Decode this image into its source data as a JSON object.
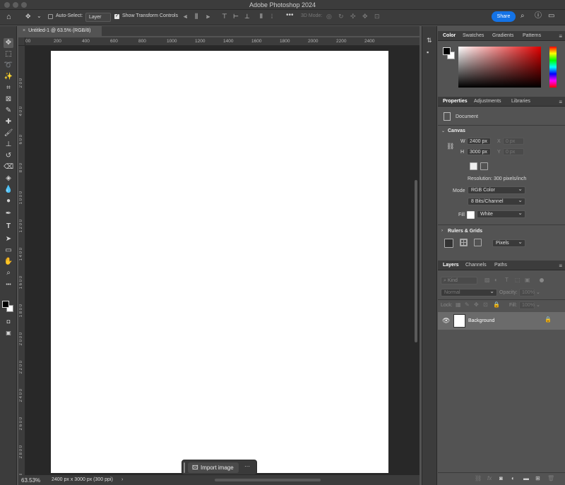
{
  "app": {
    "title": "Adobe Photoshop 2024"
  },
  "options_bar": {
    "auto_select_label": "Auto-Select:",
    "auto_select_target": "Layer",
    "show_transform_label": "Show Transform Controls",
    "mode_3d_label": "3D Mode:",
    "share_label": "Share"
  },
  "document": {
    "tab_title": "Untitled-1 @ 63.5% (RGB/8)",
    "zoom": "63.53%",
    "info": "2400 px x 3000 px (300 ppi)"
  },
  "rulers": {
    "top": [
      "00",
      "200",
      "400",
      "600",
      "800",
      "1000",
      "1200",
      "1400",
      "1600",
      "1800",
      "2000",
      "2200",
      "2400"
    ],
    "left": [
      "2 0 0",
      "4 0 0",
      "6 0 0",
      "8 0 0",
      "1 0 0 0",
      "1 2 0 0",
      "1 4 0 0",
      "1 6 0 0",
      "1 8 0 0",
      "2 0 0 0",
      "2 2 0 0",
      "2 4 0 0",
      "2 6 0 0",
      "2 8 0 0",
      "3"
    ]
  },
  "context_bar": {
    "import_label": "Import image",
    "more_label": "···"
  },
  "color_panel": {
    "tabs": [
      "Color",
      "Swatches",
      "Gradients",
      "Patterns"
    ],
    "foreground": "#000000",
    "background": "#ffffff"
  },
  "properties_panel": {
    "tabs": [
      "Properties",
      "Adjustments",
      "Libraries"
    ],
    "doc_label": "Document",
    "canvas_section": "Canvas",
    "w_label": "W",
    "w_value": "2400 px",
    "h_label": "H",
    "h_value": "3000 px",
    "x_label": "X",
    "x_value": "0 px",
    "y_label": "Y",
    "y_value": "0 px",
    "resolution": "Resolution: 300 pixels/inch",
    "mode_label": "Mode",
    "mode_value": "RGB Color",
    "bits_value": "8 Bits/Channel",
    "fill_label": "Fill",
    "fill_value": "White",
    "rulers_section": "Rulers & Grids",
    "units_value": "Pixels"
  },
  "layers_panel": {
    "tabs": [
      "Layers",
      "Channels",
      "Paths"
    ],
    "search_placeholder": "Kind",
    "blend_mode": "Normal",
    "opacity_label": "Opacity:",
    "opacity_value": "100%",
    "lock_label": "Lock:",
    "fill_label": "Fill:",
    "fill_value": "100%",
    "layer_name": "Background"
  }
}
